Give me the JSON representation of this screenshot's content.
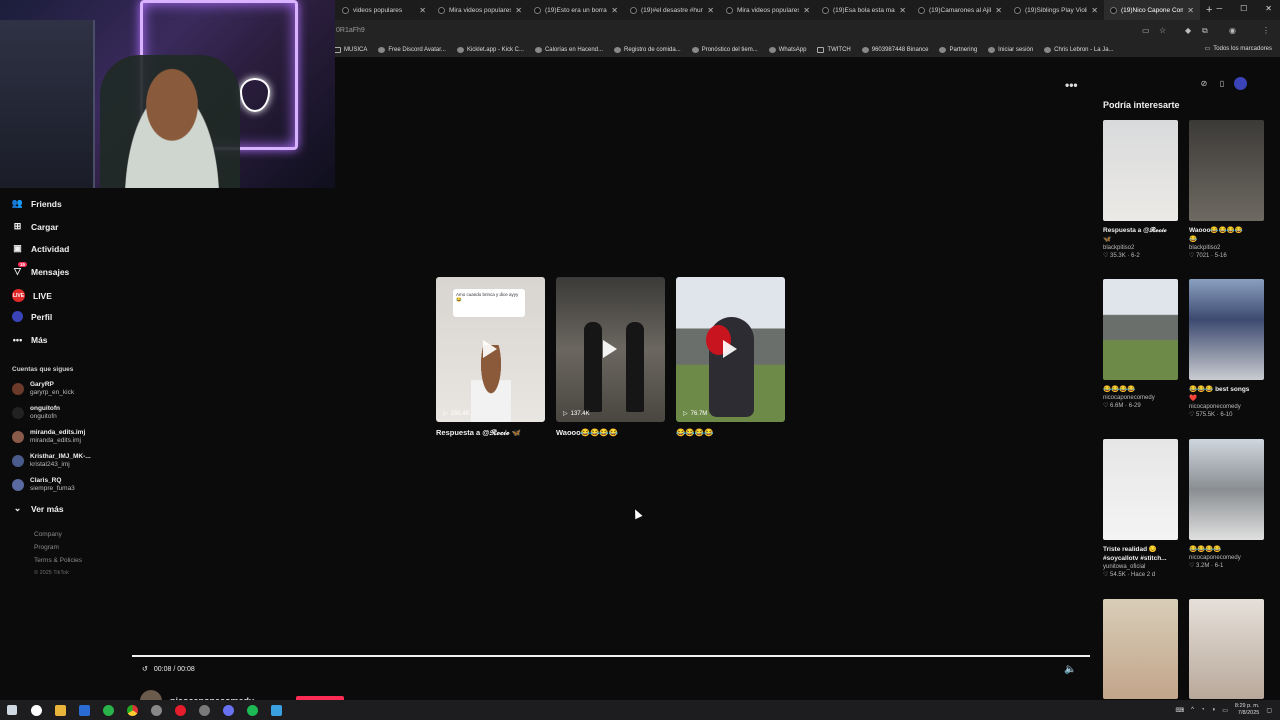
{
  "browser": {
    "tabs": [
      {
        "label": "videos populares",
        "active": false
      },
      {
        "label": "Mira videos populares",
        "active": false
      },
      {
        "label": "(19)Esto era un borrado",
        "active": false
      },
      {
        "label": "(19)#el desastre #hum",
        "active": false
      },
      {
        "label": "Mira videos populares",
        "active": false
      },
      {
        "label": "(19)Esa bola esta mal",
        "active": false
      },
      {
        "label": "(19)Camarones al Ajillo",
        "active": false
      },
      {
        "label": "(19)Siblings Play Violin",
        "active": false
      },
      {
        "label": "(19)Nico Capone Comedy",
        "active": true
      }
    ],
    "new_tab": "+",
    "url_fragment": "0R1aFh9",
    "bookmarks": [
      {
        "label": "MUSICA",
        "kind": "folder"
      },
      {
        "label": "Free Discord Avatar...",
        "kind": "site"
      },
      {
        "label": "Kicklet.app - Kick C...",
        "kind": "site"
      },
      {
        "label": "Calorías en Hacend...",
        "kind": "site"
      },
      {
        "label": "Registro de comida...",
        "kind": "site"
      },
      {
        "label": "Pronóstico del tiem...",
        "kind": "site"
      },
      {
        "label": "WhatsApp",
        "kind": "site"
      },
      {
        "label": "TWITCH",
        "kind": "folder"
      },
      {
        "label": "9603987448 Binance",
        "kind": "site"
      },
      {
        "label": "Partnering",
        "kind": "site"
      },
      {
        "label": "Iniciar sesión",
        "kind": "site"
      },
      {
        "label": "Chris Lebron - La Ja...",
        "kind": "site"
      }
    ],
    "all_bookmarks": "Todos los marcadores"
  },
  "sidebar": {
    "nav": [
      {
        "label": "Friends",
        "icon": "friends-icon"
      },
      {
        "label": "Cargar",
        "icon": "upload-icon"
      },
      {
        "label": "Actividad",
        "icon": "activity-icon"
      },
      {
        "label": "Mensajes",
        "icon": "messages-icon",
        "badge": "15"
      },
      {
        "label": "LIVE",
        "icon": "live-icon"
      },
      {
        "label": "Perfil",
        "icon": "profile-icon"
      },
      {
        "label": "Más",
        "icon": "more-icon"
      }
    ],
    "following_title": "Cuentas que sigues",
    "following": [
      {
        "name": "GaryRP",
        "handle": "garyrp_en_kick"
      },
      {
        "name": "onguitofn",
        "handle": "onguitofn"
      },
      {
        "name": "miranda_edits.imj",
        "handle": "miranda_edits.imj"
      },
      {
        "name": "Kristhar_IMJ_MK-...",
        "handle": "kristal243_imj"
      },
      {
        "name": "Claris_RQ",
        "handle": "siempre_fuma3"
      }
    ],
    "see_more": "Ver más",
    "footer": [
      "Company",
      "Program",
      "Terms & Policies",
      "© 2025 TikTok"
    ]
  },
  "main": {
    "videos": [
      {
        "caption": "Respuesta a @𝓡𝓸𝓬𝓲𝓸 🦋",
        "views": "250.4K",
        "note": "Amo cuando brinca y dice ayyy😂"
      },
      {
        "caption": "Waooo😂😂😂😂",
        "views": "137.4K"
      },
      {
        "caption": "😂😂😂😂",
        "views": "76.7M"
      }
    ],
    "time": "00:08 / 00:08",
    "author": "nicocaponecomedy"
  },
  "recommended": {
    "title": "Podría interesarte",
    "items": [
      {
        "caption": "Respuesta a @𝓡𝓸𝓬𝓲𝓸",
        "caption2": "🦋",
        "user": "blackpitiso2",
        "stats": "♡ 35.3K · 6-2"
      },
      {
        "caption": "Waooo😂😂😂😂",
        "caption2": "😂",
        "user": "blackpitiso2",
        "stats": "♡ 7021 · 5-16"
      },
      {
        "caption": "😂😂😂😂",
        "caption2": "",
        "user": "nicocaponecomedy",
        "stats": "♡ 6.6M · 6-29"
      },
      {
        "caption": "😂😂😂 best songs",
        "caption2": "❤️",
        "user": "nicocaponecomedy",
        "stats": "♡ 575.5K · 6-10"
      },
      {
        "caption": "Triste realidad 😔",
        "caption2": "#soycallotv #stitch...",
        "user": "yunitowa_oficial",
        "stats": "♡ 54.5K · Hace 2 d"
      },
      {
        "caption": "😂😂😂😂",
        "caption2": "",
        "user": "nicocaponecomedy",
        "stats": "♡ 3.2M · 6-1"
      }
    ]
  },
  "taskbar": {
    "time": "8:29 p. m.",
    "date": "7/8/2025"
  },
  "colors": {
    "accent": "#fe2c55",
    "background": "#0b0b0b"
  }
}
